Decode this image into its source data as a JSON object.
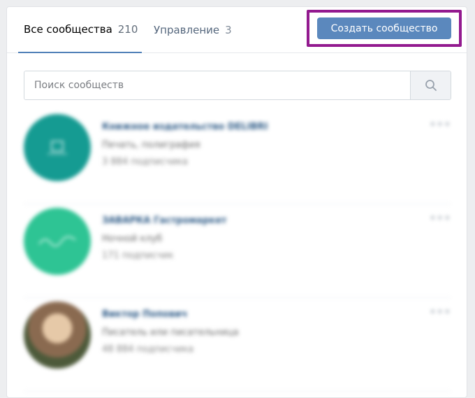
{
  "tabs": {
    "all": {
      "label": "Все сообщества",
      "count": "210"
    },
    "manage": {
      "label": "Управление",
      "count": "3"
    }
  },
  "create_button": {
    "label": "Создать сообщество"
  },
  "search": {
    "placeholder": "Поиск сообществ",
    "icon": "search-icon"
  },
  "communities": [
    {
      "name": "Книжное издательство DELIBRI",
      "desc": "Печать, полиграфия",
      "subs": "3 884 подписчика",
      "avatar_color": "#159b92",
      "avatar_icon": "publisher-logo"
    },
    {
      "name": "ЗАВАРКА Гастромаркет",
      "desc": "Ночной клуб",
      "subs": "171 подписчик",
      "avatar_color": "#2ec494",
      "avatar_icon": "script-logo"
    },
    {
      "name": "Виктор Попович",
      "desc": "Писатель или писательница",
      "subs": "48 884 подписчика",
      "avatar_color": "#7a5a44",
      "avatar_icon": "person-photo"
    }
  ],
  "colors": {
    "accent": "#5181b8",
    "button": "#5b88bd",
    "highlight": "#931a8f"
  }
}
